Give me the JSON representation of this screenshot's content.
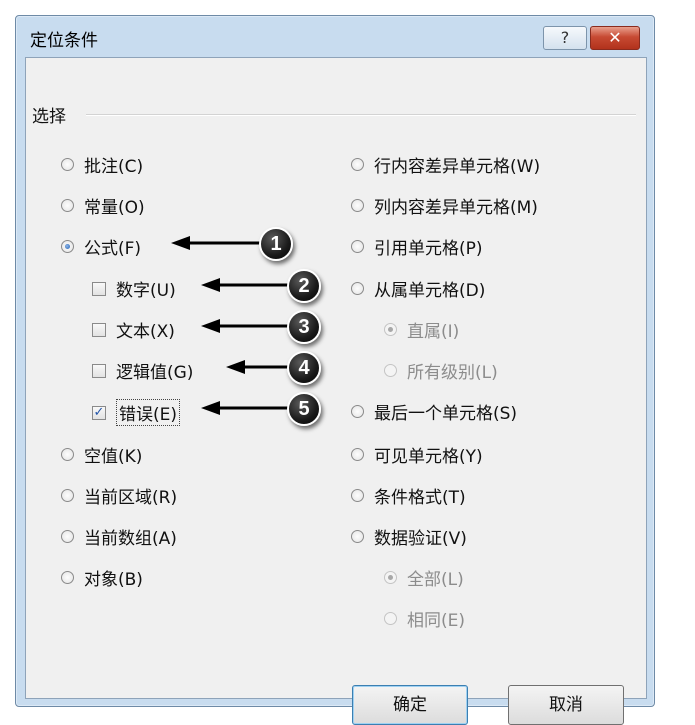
{
  "window": {
    "title": "定位条件",
    "help_label": "?",
    "close_label": "✕"
  },
  "group": {
    "label": "选择"
  },
  "left_options": [
    {
      "label": "批注(C)",
      "type": "radio",
      "checked": false
    },
    {
      "label": "常量(O)",
      "type": "radio",
      "checked": false
    },
    {
      "label": "公式(F)",
      "type": "radio",
      "checked": true
    },
    {
      "label": "数字(U)",
      "type": "checkbox",
      "checked": false
    },
    {
      "label": "文本(X)",
      "type": "checkbox",
      "checked": false
    },
    {
      "label": "逻辑值(G)",
      "type": "checkbox",
      "checked": false
    },
    {
      "label": "错误(E)",
      "type": "checkbox",
      "checked": true
    },
    {
      "label": "空值(K)",
      "type": "radio",
      "checked": false
    },
    {
      "label": "当前区域(R)",
      "type": "radio",
      "checked": false
    },
    {
      "label": "当前数组(A)",
      "type": "radio",
      "checked": false
    },
    {
      "label": "对象(B)",
      "type": "radio",
      "checked": false
    }
  ],
  "right_options": [
    {
      "label": "行内容差异单元格(W)",
      "type": "radio",
      "checked": false,
      "disabled": false
    },
    {
      "label": "列内容差异单元格(M)",
      "type": "radio",
      "checked": false,
      "disabled": false
    },
    {
      "label": "引用单元格(P)",
      "type": "radio",
      "checked": false,
      "disabled": false
    },
    {
      "label": "从属单元格(D)",
      "type": "radio",
      "checked": false,
      "disabled": false
    },
    {
      "label": "直属(I)",
      "type": "radio",
      "checked": true,
      "disabled": true
    },
    {
      "label": "所有级别(L)",
      "type": "radio",
      "checked": false,
      "disabled": true
    },
    {
      "label": "最后一个单元格(S)",
      "type": "radio",
      "checked": false,
      "disabled": false
    },
    {
      "label": "可见单元格(Y)",
      "type": "radio",
      "checked": false,
      "disabled": false
    },
    {
      "label": "条件格式(T)",
      "type": "radio",
      "checked": false,
      "disabled": false
    },
    {
      "label": "数据验证(V)",
      "type": "radio",
      "checked": false,
      "disabled": false
    },
    {
      "label": "全部(L)",
      "type": "radio",
      "checked": true,
      "disabled": true
    },
    {
      "label": "相同(E)",
      "type": "radio",
      "checked": false,
      "disabled": true
    }
  ],
  "callouts": [
    "1",
    "2",
    "3",
    "4",
    "5"
  ],
  "buttons": {
    "ok_label": "确定",
    "cancel_label": "取消"
  },
  "colors": {
    "title_bar": "#c8dcef",
    "close_button": "#c74a33",
    "default_button_border": "#3c7fb1"
  }
}
